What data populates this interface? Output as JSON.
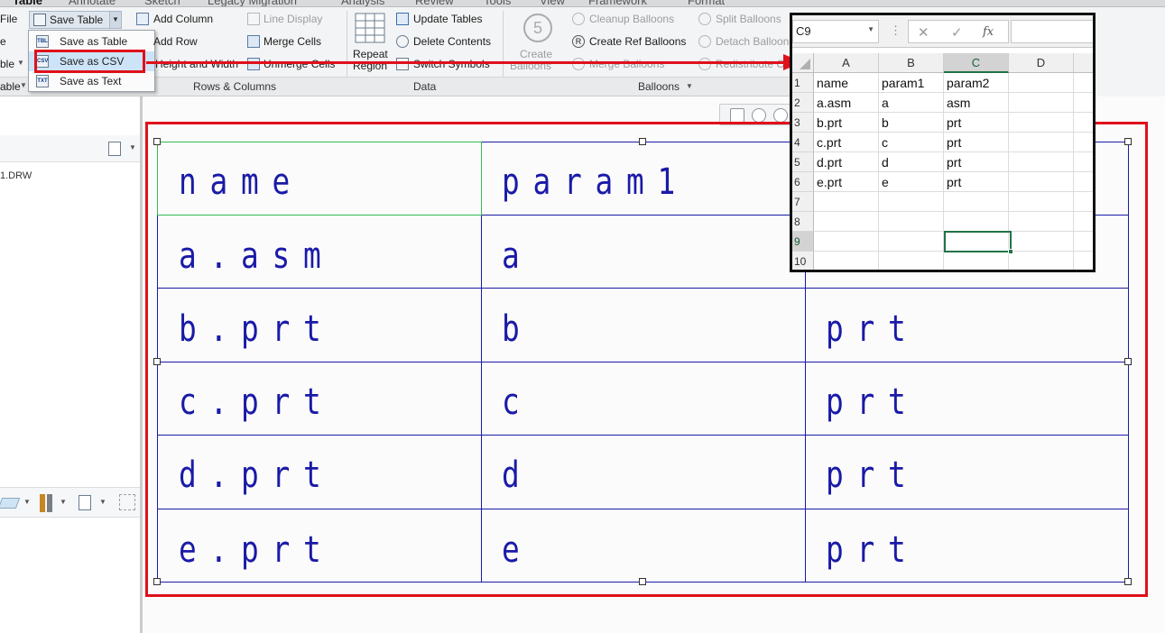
{
  "tabs": [
    "Table",
    "Annotate",
    "Sketch",
    "Legacy Migration",
    "Analysis",
    "Review",
    "Tools",
    "View",
    "Framework",
    "Format"
  ],
  "ribbon": {
    "left_partial": [
      "File",
      "e",
      "ble",
      "able"
    ],
    "save_table": "Save Table",
    "dropdown": [
      {
        "label": "Save as Table",
        "icon": "TBL"
      },
      {
        "label": "Save as CSV",
        "icon": "CSV"
      },
      {
        "label": "Save as Text",
        "icon": "TXT"
      }
    ],
    "rows_columns": {
      "add_column": "Add Column",
      "add_row": "Add Row",
      "height_width": "Height and Width",
      "line_display": "Line Display",
      "merge_cells": "Merge Cells",
      "unmerge_cells": "Unmerge Cells",
      "group": "Rows & Columns"
    },
    "data": {
      "repeat_region_1": "Repeat",
      "repeat_region_2": "Region",
      "update_tables": "Update Tables",
      "delete_contents": "Delete Contents",
      "switch_symbols": "Switch Symbols",
      "group": "Data"
    },
    "balloons": {
      "create_1": "Create",
      "create_2": "Balloons",
      "cleanup": "Cleanup Balloons",
      "create_ref": "Create Ref Balloons",
      "merge": "Merge Balloons",
      "split": "Split Balloons",
      "detach": "Detach Balloon",
      "redistribute": "Redistribute C",
      "group": "Balloons",
      "big_icon_num": "5"
    }
  },
  "left_panel": {
    "drawing_name": "1.DRW"
  },
  "drawing_table": {
    "rows": [
      [
        "name",
        "param1",
        ""
      ],
      [
        "a.asm",
        "a",
        ""
      ],
      [
        "b.prt",
        "b",
        "prt"
      ],
      [
        "c.prt",
        "c",
        "prt"
      ],
      [
        "d.prt",
        "d",
        "prt"
      ],
      [
        "e.prt",
        "e",
        "prt"
      ]
    ]
  },
  "spreadsheet": {
    "name_box": "C9",
    "fx": "fx",
    "columns": [
      "A",
      "B",
      "C",
      "D"
    ],
    "row_numbers": [
      "1",
      "2",
      "3",
      "4",
      "5",
      "6",
      "7",
      "8",
      "9",
      "10"
    ],
    "cells": [
      [
        "name",
        "param1",
        "param2",
        ""
      ],
      [
        "a.asm",
        "a",
        "asm",
        ""
      ],
      [
        "b.prt",
        "b",
        "prt",
        ""
      ],
      [
        "c.prt",
        "c",
        "prt",
        ""
      ],
      [
        "d.prt",
        "d",
        "prt",
        ""
      ],
      [
        "e.prt",
        "e",
        "prt",
        ""
      ],
      [
        "",
        "",
        "",
        ""
      ],
      [
        "",
        "",
        "",
        ""
      ],
      [
        "",
        "",
        "",
        ""
      ],
      [
        "",
        "",
        "",
        ""
      ]
    ]
  },
  "colors": {
    "highlight_red": "#e0101b",
    "drawing_blue": "#1a1aa8",
    "excel_green": "#217346"
  }
}
